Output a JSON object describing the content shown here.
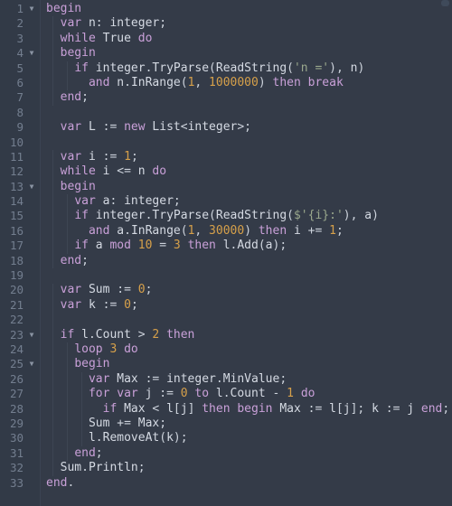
{
  "editor": {
    "title": "code-editor",
    "language": "PascalABC.NET",
    "background_color": "#343b48",
    "gutter_color": "#323a47",
    "line_number_color": "#737e8f",
    "total_lines": 33,
    "first_visible_line": 1,
    "fold_marker_glyph": "▼",
    "fold_lines": [
      1,
      4,
      13,
      23,
      25
    ],
    "colors": {
      "keyword": "#c9a0d8",
      "identifier": "#d5dae3",
      "number": "#d6a04a",
      "string": "#9aa88d",
      "operator": "#cdd3dc"
    },
    "lines": [
      {
        "n": 1,
        "fold": true,
        "tokens": [
          {
            "t": "kw",
            "s": "begin"
          }
        ]
      },
      {
        "n": 2,
        "fold": false,
        "tokens": [
          {
            "t": "id",
            "s": "  "
          },
          {
            "t": "kw",
            "s": "var"
          },
          {
            "t": "id",
            "s": " n"
          },
          {
            "t": "punc",
            "s": ": "
          },
          {
            "t": "id",
            "s": "integer"
          },
          {
            "t": "punc",
            "s": ";"
          }
        ]
      },
      {
        "n": 3,
        "fold": false,
        "tokens": [
          {
            "t": "id",
            "s": "  "
          },
          {
            "t": "kw",
            "s": "while"
          },
          {
            "t": "id",
            "s": " True "
          },
          {
            "t": "kw",
            "s": "do"
          }
        ]
      },
      {
        "n": 4,
        "fold": true,
        "tokens": [
          {
            "t": "id",
            "s": "  "
          },
          {
            "t": "kw",
            "s": "begin"
          }
        ]
      },
      {
        "n": 5,
        "fold": false,
        "tokens": [
          {
            "t": "id",
            "s": "    "
          },
          {
            "t": "kw",
            "s": "if"
          },
          {
            "t": "id",
            "s": " integer"
          },
          {
            "t": "punc",
            "s": "."
          },
          {
            "t": "id",
            "s": "TryParse"
          },
          {
            "t": "punc",
            "s": "("
          },
          {
            "t": "id",
            "s": "ReadString"
          },
          {
            "t": "punc",
            "s": "("
          },
          {
            "t": "str",
            "s": "'n ='"
          },
          {
            "t": "punc",
            "s": "), "
          },
          {
            "t": "id",
            "s": "n"
          },
          {
            "t": "punc",
            "s": ")"
          }
        ]
      },
      {
        "n": 6,
        "fold": false,
        "tokens": [
          {
            "t": "id",
            "s": "      "
          },
          {
            "t": "kw",
            "s": "and"
          },
          {
            "t": "id",
            "s": " n"
          },
          {
            "t": "punc",
            "s": "."
          },
          {
            "t": "id",
            "s": "InRange"
          },
          {
            "t": "punc",
            "s": "("
          },
          {
            "t": "num",
            "s": "1"
          },
          {
            "t": "punc",
            "s": ", "
          },
          {
            "t": "num",
            "s": "1000000"
          },
          {
            "t": "punc",
            "s": ") "
          },
          {
            "t": "kw",
            "s": "then break"
          }
        ]
      },
      {
        "n": 7,
        "fold": false,
        "tokens": [
          {
            "t": "id",
            "s": "  "
          },
          {
            "t": "kw",
            "s": "end"
          },
          {
            "t": "punc",
            "s": ";"
          }
        ]
      },
      {
        "n": 8,
        "fold": false,
        "tokens": []
      },
      {
        "n": 9,
        "fold": false,
        "tokens": [
          {
            "t": "id",
            "s": "  "
          },
          {
            "t": "kw",
            "s": "var"
          },
          {
            "t": "id",
            "s": " L "
          },
          {
            "t": "op",
            "s": ":="
          },
          {
            "t": "id",
            "s": " "
          },
          {
            "t": "kw",
            "s": "new"
          },
          {
            "t": "id",
            "s": " List"
          },
          {
            "t": "punc",
            "s": "<"
          },
          {
            "t": "id",
            "s": "integer"
          },
          {
            "t": "punc",
            "s": ">;"
          }
        ]
      },
      {
        "n": 10,
        "fold": false,
        "tokens": []
      },
      {
        "n": 11,
        "fold": false,
        "tokens": [
          {
            "t": "id",
            "s": "  "
          },
          {
            "t": "kw",
            "s": "var"
          },
          {
            "t": "id",
            "s": " i "
          },
          {
            "t": "op",
            "s": ":="
          },
          {
            "t": "id",
            "s": " "
          },
          {
            "t": "num",
            "s": "1"
          },
          {
            "t": "punc",
            "s": ";"
          }
        ]
      },
      {
        "n": 12,
        "fold": false,
        "tokens": [
          {
            "t": "id",
            "s": "  "
          },
          {
            "t": "kw",
            "s": "while"
          },
          {
            "t": "id",
            "s": " i "
          },
          {
            "t": "op",
            "s": "<="
          },
          {
            "t": "id",
            "s": " n "
          },
          {
            "t": "kw",
            "s": "do"
          }
        ]
      },
      {
        "n": 13,
        "fold": true,
        "tokens": [
          {
            "t": "id",
            "s": "  "
          },
          {
            "t": "kw",
            "s": "begin"
          }
        ]
      },
      {
        "n": 14,
        "fold": false,
        "tokens": [
          {
            "t": "id",
            "s": "    "
          },
          {
            "t": "kw",
            "s": "var"
          },
          {
            "t": "id",
            "s": " a"
          },
          {
            "t": "punc",
            "s": ": "
          },
          {
            "t": "id",
            "s": "integer"
          },
          {
            "t": "punc",
            "s": ";"
          }
        ]
      },
      {
        "n": 15,
        "fold": false,
        "tokens": [
          {
            "t": "id",
            "s": "    "
          },
          {
            "t": "kw",
            "s": "if"
          },
          {
            "t": "id",
            "s": " integer"
          },
          {
            "t": "punc",
            "s": "."
          },
          {
            "t": "id",
            "s": "TryParse"
          },
          {
            "t": "punc",
            "s": "("
          },
          {
            "t": "id",
            "s": "ReadString"
          },
          {
            "t": "punc",
            "s": "("
          },
          {
            "t": "str",
            "s": "$'{i}:'"
          },
          {
            "t": "punc",
            "s": "), "
          },
          {
            "t": "id",
            "s": "a"
          },
          {
            "t": "punc",
            "s": ")"
          }
        ]
      },
      {
        "n": 16,
        "fold": false,
        "tokens": [
          {
            "t": "id",
            "s": "      "
          },
          {
            "t": "kw",
            "s": "and"
          },
          {
            "t": "id",
            "s": " a"
          },
          {
            "t": "punc",
            "s": "."
          },
          {
            "t": "id",
            "s": "InRange"
          },
          {
            "t": "punc",
            "s": "("
          },
          {
            "t": "num",
            "s": "1"
          },
          {
            "t": "punc",
            "s": ", "
          },
          {
            "t": "num",
            "s": "30000"
          },
          {
            "t": "punc",
            "s": ") "
          },
          {
            "t": "kw",
            "s": "then"
          },
          {
            "t": "id",
            "s": " i "
          },
          {
            "t": "op",
            "s": "+="
          },
          {
            "t": "id",
            "s": " "
          },
          {
            "t": "num",
            "s": "1"
          },
          {
            "t": "punc",
            "s": ";"
          }
        ]
      },
      {
        "n": 17,
        "fold": false,
        "tokens": [
          {
            "t": "id",
            "s": "    "
          },
          {
            "t": "kw",
            "s": "if"
          },
          {
            "t": "id",
            "s": " a "
          },
          {
            "t": "kw",
            "s": "mod"
          },
          {
            "t": "id",
            "s": " "
          },
          {
            "t": "num",
            "s": "10"
          },
          {
            "t": "id",
            "s": " "
          },
          {
            "t": "op",
            "s": "="
          },
          {
            "t": "id",
            "s": " "
          },
          {
            "t": "num",
            "s": "3"
          },
          {
            "t": "id",
            "s": " "
          },
          {
            "t": "kw",
            "s": "then"
          },
          {
            "t": "id",
            "s": " l"
          },
          {
            "t": "punc",
            "s": "."
          },
          {
            "t": "id",
            "s": "Add"
          },
          {
            "t": "punc",
            "s": "("
          },
          {
            "t": "id",
            "s": "a"
          },
          {
            "t": "punc",
            "s": ");"
          }
        ]
      },
      {
        "n": 18,
        "fold": false,
        "tokens": [
          {
            "t": "id",
            "s": "  "
          },
          {
            "t": "kw",
            "s": "end"
          },
          {
            "t": "punc",
            "s": ";"
          }
        ]
      },
      {
        "n": 19,
        "fold": false,
        "tokens": []
      },
      {
        "n": 20,
        "fold": false,
        "tokens": [
          {
            "t": "id",
            "s": "  "
          },
          {
            "t": "kw",
            "s": "var"
          },
          {
            "t": "id",
            "s": " Sum "
          },
          {
            "t": "op",
            "s": ":="
          },
          {
            "t": "id",
            "s": " "
          },
          {
            "t": "num",
            "s": "0"
          },
          {
            "t": "punc",
            "s": ";"
          }
        ]
      },
      {
        "n": 21,
        "fold": false,
        "tokens": [
          {
            "t": "id",
            "s": "  "
          },
          {
            "t": "kw",
            "s": "var"
          },
          {
            "t": "id",
            "s": " k "
          },
          {
            "t": "op",
            "s": ":="
          },
          {
            "t": "id",
            "s": " "
          },
          {
            "t": "num",
            "s": "0"
          },
          {
            "t": "punc",
            "s": ";"
          }
        ]
      },
      {
        "n": 22,
        "fold": false,
        "tokens": []
      },
      {
        "n": 23,
        "fold": true,
        "tokens": [
          {
            "t": "id",
            "s": "  "
          },
          {
            "t": "kw",
            "s": "if"
          },
          {
            "t": "id",
            "s": " l"
          },
          {
            "t": "punc",
            "s": "."
          },
          {
            "t": "id",
            "s": "Count "
          },
          {
            "t": "op",
            "s": ">"
          },
          {
            "t": "id",
            "s": " "
          },
          {
            "t": "num",
            "s": "2"
          },
          {
            "t": "id",
            "s": " "
          },
          {
            "t": "kw",
            "s": "then"
          }
        ]
      },
      {
        "n": 24,
        "fold": false,
        "tokens": [
          {
            "t": "id",
            "s": "    "
          },
          {
            "t": "kw",
            "s": "loop"
          },
          {
            "t": "id",
            "s": " "
          },
          {
            "t": "num",
            "s": "3"
          },
          {
            "t": "id",
            "s": " "
          },
          {
            "t": "kw",
            "s": "do"
          }
        ]
      },
      {
        "n": 25,
        "fold": true,
        "tokens": [
          {
            "t": "id",
            "s": "    "
          },
          {
            "t": "kw",
            "s": "begin"
          }
        ]
      },
      {
        "n": 26,
        "fold": false,
        "tokens": [
          {
            "t": "id",
            "s": "      "
          },
          {
            "t": "kw",
            "s": "var"
          },
          {
            "t": "id",
            "s": " Max "
          },
          {
            "t": "op",
            "s": ":="
          },
          {
            "t": "id",
            "s": " integer"
          },
          {
            "t": "punc",
            "s": "."
          },
          {
            "t": "id",
            "s": "MinValue"
          },
          {
            "t": "punc",
            "s": ";"
          }
        ]
      },
      {
        "n": 27,
        "fold": false,
        "tokens": [
          {
            "t": "id",
            "s": "      "
          },
          {
            "t": "kw",
            "s": "for"
          },
          {
            "t": "id",
            "s": " "
          },
          {
            "t": "kw",
            "s": "var"
          },
          {
            "t": "id",
            "s": " j "
          },
          {
            "t": "op",
            "s": ":="
          },
          {
            "t": "id",
            "s": " "
          },
          {
            "t": "num",
            "s": "0"
          },
          {
            "t": "id",
            "s": " "
          },
          {
            "t": "kw",
            "s": "to"
          },
          {
            "t": "id",
            "s": " l"
          },
          {
            "t": "punc",
            "s": "."
          },
          {
            "t": "id",
            "s": "Count "
          },
          {
            "t": "op",
            "s": "-"
          },
          {
            "t": "id",
            "s": " "
          },
          {
            "t": "num",
            "s": "1"
          },
          {
            "t": "id",
            "s": " "
          },
          {
            "t": "kw",
            "s": "do"
          }
        ]
      },
      {
        "n": 28,
        "fold": false,
        "tokens": [
          {
            "t": "id",
            "s": "        "
          },
          {
            "t": "kw",
            "s": "if"
          },
          {
            "t": "id",
            "s": " Max "
          },
          {
            "t": "op",
            "s": "<"
          },
          {
            "t": "id",
            "s": " l"
          },
          {
            "t": "punc",
            "s": "["
          },
          {
            "t": "id",
            "s": "j"
          },
          {
            "t": "punc",
            "s": "] "
          },
          {
            "t": "kw",
            "s": "then begin"
          },
          {
            "t": "id",
            "s": " Max "
          },
          {
            "t": "op",
            "s": ":="
          },
          {
            "t": "id",
            "s": " l"
          },
          {
            "t": "punc",
            "s": "["
          },
          {
            "t": "id",
            "s": "j"
          },
          {
            "t": "punc",
            "s": "]; "
          },
          {
            "t": "id",
            "s": "k "
          },
          {
            "t": "op",
            "s": ":="
          },
          {
            "t": "id",
            "s": " j "
          },
          {
            "t": "kw",
            "s": "end"
          },
          {
            "t": "punc",
            "s": ";"
          }
        ]
      },
      {
        "n": 29,
        "fold": false,
        "tokens": [
          {
            "t": "id",
            "s": "      Sum "
          },
          {
            "t": "op",
            "s": "+="
          },
          {
            "t": "id",
            "s": " Max"
          },
          {
            "t": "punc",
            "s": ";"
          }
        ]
      },
      {
        "n": 30,
        "fold": false,
        "tokens": [
          {
            "t": "id",
            "s": "      l"
          },
          {
            "t": "punc",
            "s": "."
          },
          {
            "t": "id",
            "s": "RemoveAt"
          },
          {
            "t": "punc",
            "s": "("
          },
          {
            "t": "id",
            "s": "k"
          },
          {
            "t": "punc",
            "s": ");"
          }
        ]
      },
      {
        "n": 31,
        "fold": false,
        "tokens": [
          {
            "t": "id",
            "s": "    "
          },
          {
            "t": "kw",
            "s": "end"
          },
          {
            "t": "punc",
            "s": ";"
          }
        ]
      },
      {
        "n": 32,
        "fold": false,
        "tokens": [
          {
            "t": "id",
            "s": "  Sum"
          },
          {
            "t": "punc",
            "s": "."
          },
          {
            "t": "id",
            "s": "Println"
          },
          {
            "t": "punc",
            "s": ";"
          }
        ]
      },
      {
        "n": 33,
        "fold": false,
        "tokens": [
          {
            "t": "kw",
            "s": "end"
          },
          {
            "t": "punc",
            "s": "."
          }
        ]
      }
    ],
    "indent_guides": [
      {
        "x": 58,
        "from_line": 2,
        "to_line": 7
      },
      {
        "x": 74,
        "from_line": 5,
        "to_line": 6
      },
      {
        "x": 58,
        "from_line": 11,
        "to_line": 18
      },
      {
        "x": 74,
        "from_line": 14,
        "to_line": 17
      },
      {
        "x": 58,
        "from_line": 20,
        "to_line": 32
      },
      {
        "x": 74,
        "from_line": 24,
        "to_line": 31
      },
      {
        "x": 90,
        "from_line": 26,
        "to_line": 30
      }
    ]
  }
}
